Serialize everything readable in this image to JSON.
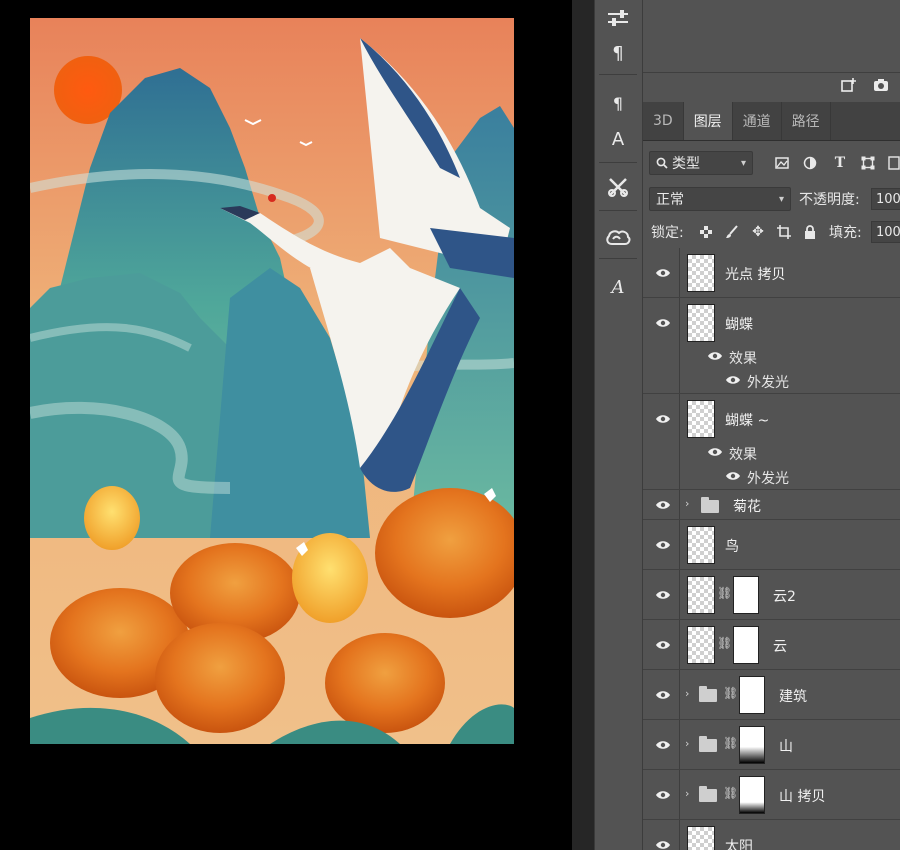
{
  "panel": {
    "tabs": [
      "3D",
      "图层",
      "通道",
      "路径"
    ],
    "active_tab": "图层",
    "filter": {
      "kind_label": "类型"
    },
    "blend": {
      "mode": "正常",
      "opacity_label": "不透明度:",
      "opacity_value": "100%"
    },
    "lock": {
      "label": "锁定:",
      "fill_label": "填充:",
      "fill_value": "100%"
    }
  },
  "layers": [
    {
      "name": "光点 拷贝",
      "type": "pixel"
    },
    {
      "name": "蝴蝶",
      "type": "pixel",
      "effects_label": "效果",
      "effects": [
        "外发光"
      ]
    },
    {
      "name": "蝴蝶 ~",
      "type": "pixel",
      "effects_label": "效果",
      "effects": [
        "外发光"
      ]
    },
    {
      "name": "菊花",
      "type": "group"
    },
    {
      "name": "鸟",
      "type": "pixel"
    },
    {
      "name": "云2",
      "type": "masked"
    },
    {
      "name": "云",
      "type": "masked"
    },
    {
      "name": "建筑",
      "type": "group-masked"
    },
    {
      "name": "山",
      "type": "group-masked"
    },
    {
      "name": "山 拷贝",
      "type": "group-masked"
    },
    {
      "name": "太阳",
      "type": "pixel"
    }
  ],
  "toolstrip_icons": [
    "properties-icon",
    "paragraph-icon",
    "paragraph-style-icon",
    "character-style-icon",
    "tools-preset-icon",
    "creative-cloud-icon",
    "glyphs-icon"
  ],
  "colors": {
    "panel_bg": "#535353",
    "tab_bar": "#424242",
    "canvas_bg": "#000000"
  }
}
